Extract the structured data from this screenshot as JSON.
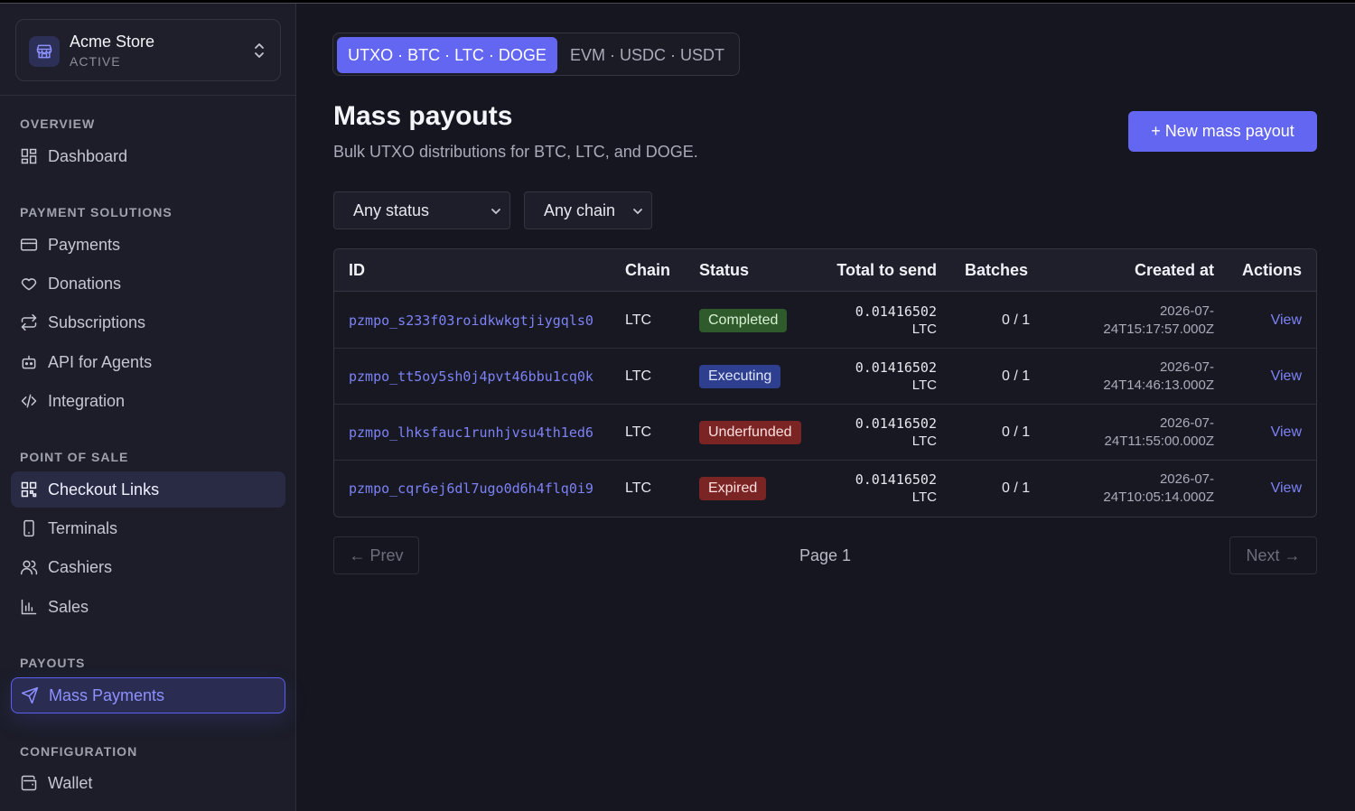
{
  "store": {
    "name": "Acme Store",
    "status": "ACTIVE"
  },
  "sidebar": {
    "sections": [
      {
        "title": "OVERVIEW",
        "items": [
          {
            "label": "Dashboard",
            "icon": "dashboard-icon"
          }
        ]
      },
      {
        "title": "PAYMENT SOLUTIONS",
        "items": [
          {
            "label": "Payments",
            "icon": "card-icon"
          },
          {
            "label": "Donations",
            "icon": "heart-icon"
          },
          {
            "label": "Subscriptions",
            "icon": "repeat-icon"
          },
          {
            "label": "API for Agents",
            "icon": "robot-icon"
          },
          {
            "label": "Integration",
            "icon": "code-icon"
          }
        ]
      },
      {
        "title": "POINT OF SALE",
        "items": [
          {
            "label": "Checkout Links",
            "icon": "qr-icon"
          },
          {
            "label": "Terminals",
            "icon": "phone-icon"
          },
          {
            "label": "Cashiers",
            "icon": "users-icon"
          },
          {
            "label": "Sales",
            "icon": "bar-chart-icon"
          }
        ]
      },
      {
        "title": "PAYOUTS",
        "items": [
          {
            "label": "Mass Payments",
            "icon": "send-icon"
          }
        ]
      },
      {
        "title": "CONFIGURATION",
        "items": [
          {
            "label": "Wallet",
            "icon": "wallet-icon"
          }
        ]
      }
    ]
  },
  "tabs": [
    {
      "label": "UTXO · BTC · LTC · DOGE",
      "active": true
    },
    {
      "label": "EVM · USDC · USDT",
      "active": false
    }
  ],
  "header": {
    "title": "Mass payouts",
    "subtitle": "Bulk UTXO distributions for BTC, LTC, and DOGE.",
    "new_button": "+ New mass payout"
  },
  "filters": {
    "status": "Any status",
    "chain": "Any chain"
  },
  "table": {
    "columns": [
      "ID",
      "Chain",
      "Status",
      "Total to send",
      "Batches",
      "Created at",
      "Actions"
    ],
    "rows": [
      {
        "id": "pzmpo_s233f03roidkwkgtjiygqls0",
        "chain": "LTC",
        "status": "Completed",
        "amount": "0.01416502",
        "unit": "LTC",
        "batches": "0 / 1",
        "created_1": "2026-07-",
        "created_2": "24T15:17:57.000Z",
        "action": "View"
      },
      {
        "id": "pzmpo_tt5oy5sh0j4pvt46bbu1cq0k",
        "chain": "LTC",
        "status": "Executing",
        "amount": "0.01416502",
        "unit": "LTC",
        "batches": "0 / 1",
        "created_1": "2026-07-",
        "created_2": "24T14:46:13.000Z",
        "action": "View"
      },
      {
        "id": "pzmpo_lhksfauc1runhjvsu4th1ed6",
        "chain": "LTC",
        "status": "Underfunded",
        "amount": "0.01416502",
        "unit": "LTC",
        "batches": "0 / 1",
        "created_1": "2026-07-",
        "created_2": "24T11:55:00.000Z",
        "action": "View"
      },
      {
        "id": "pzmpo_cqr6ej6dl7ugo0d6h4flq0i9",
        "chain": "LTC",
        "status": "Expired",
        "amount": "0.01416502",
        "unit": "LTC",
        "batches": "0 / 1",
        "created_1": "2026-07-",
        "created_2": "24T10:05:14.000Z",
        "action": "View"
      }
    ]
  },
  "pagination": {
    "prev": "← Prev",
    "page": "Page 1",
    "next": "Next →"
  },
  "colors": {
    "accent": "#6366f1",
    "completed": "#2f5a2b",
    "executing": "#2f3f8f",
    "error": "#7a2424"
  }
}
